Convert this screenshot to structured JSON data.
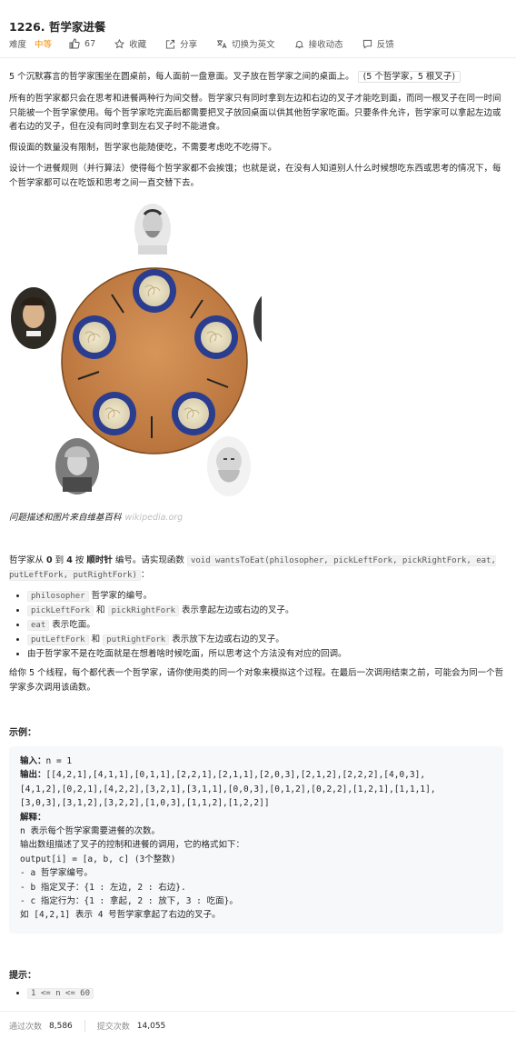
{
  "problem": {
    "title": "1226. 哲学家进餐",
    "difficulty_label": "难度",
    "difficulty": "中等",
    "likes": "67",
    "collect": "收藏",
    "share": "分享",
    "switch_lang": "切换为英文",
    "notify": "接收动态",
    "feedback": "反馈"
  },
  "description": {
    "p1": "5 个沉默寡言的哲学家围坐在圆桌前，每人面前一盘意面。叉子放在哲学家之间的桌面上。",
    "p1_note": "(5 个哲学家，5 根叉子)",
    "p2": "所有的哲学家都只会在思考和进餐两种行为间交替。哲学家只有同时拿到左边和右边的叉子才能吃到面，而同一根叉子在同一时间只能被一个哲学家使用。每个哲学家吃完面后都需要把叉子放回桌面以供其他哲学家吃面。只要条件允许，哲学家可以拿起左边或者右边的叉子，但在没有同时拿到左右叉子时不能进食。",
    "p3": "假设面的数量没有限制，哲学家也能随便吃，不需要考虑吃不吃得下。",
    "p4": "设计一个进餐规则（并行算法）使得每个哲学家都不会挨饿；也就是说，在没有人知道别人什么时候想吃东西或思考的情况下，每个哲学家都可以在吃饭和思考之间一直交替下去。",
    "caption": "问题描述和图片来自维基百科",
    "caption_source": "wikipedia.org",
    "p5_a": "哲学家从 ",
    "p5_b": "0",
    "p5_c": " 到 ",
    "p5_d": "4",
    "p5_e": " 按 ",
    "p5_f": "顺时针",
    "p5_g": " 编号。请实现函数 ",
    "p5_code": "void wantsToEat(philosopher, pickLeftFork, pickRightFork, eat, putLeftFork, putRightFork)",
    "p5_end": "：",
    "bullets": {
      "b1_code": "philosopher",
      "b1_text": " 哲学家的编号。",
      "b2_code1": "pickLeftFork",
      "b2_mid": " 和 ",
      "b2_code2": "pickRightFork",
      "b2_text": " 表示拿起左边或右边的叉子。",
      "b3_code": "eat",
      "b3_text": " 表示吃面。",
      "b4_code1": "putLeftFork",
      "b4_mid": " 和 ",
      "b4_code2": "putRightFork",
      "b4_text": " 表示放下左边或右边的叉子。",
      "b5_text": "由于哲学家不是在吃面就是在想着啥时候吃面，所以思考这个方法没有对应的回调。"
    },
    "p6": "给你 5 个线程，每个都代表一个哲学家，请你使用类的同一个对象来模拟这个过程。在最后一次调用结束之前，可能会为同一个哲学家多次调用该函数。"
  },
  "example": {
    "heading": "示例：",
    "input_label": "输入：",
    "input_value": "n = 1",
    "output_label": "输出：",
    "output_value": "[[4,2,1],[4,1,1],[0,1,1],[2,2,1],[2,1,1],[2,0,3],[2,1,2],[2,2,2],[4,0,3],\n[4,1,2],[0,2,1],[4,2,2],[3,2,1],[3,1,1],[0,0,3],[0,1,2],[0,2,2],[1,2,1],[1,1,1],\n[3,0,3],[3,1,2],[3,2,2],[1,0,3],[1,1,2],[1,2,2]]",
    "explain_label": "解释：",
    "explain_text": "n 表示每个哲学家需要进餐的次数。\n输出数组描述了叉子的控制和进餐的调用，它的格式如下：\noutput[i] = [a, b, c] (3个整数)\n- a 哲学家编号。\n- b 指定叉子：{1 : 左边, 2 : 右边}.\n- c 指定行为：{1 : 拿起, 2 : 放下, 3 : 吃面}。\n如 [4,2,1] 表示 4 号哲学家拿起了右边的叉子。"
  },
  "hints": {
    "heading": "提示：",
    "items": [
      "1 <= n <= 60"
    ]
  },
  "stats": {
    "accepted_label": "通过次数",
    "accepted_value": "8,586",
    "submitted_label": "提交次数",
    "submitted_value": "14,055"
  },
  "colors": {
    "difficulty_medium": "#ef8f0f",
    "table": "#c88245",
    "plate": "#2a3d8f"
  }
}
